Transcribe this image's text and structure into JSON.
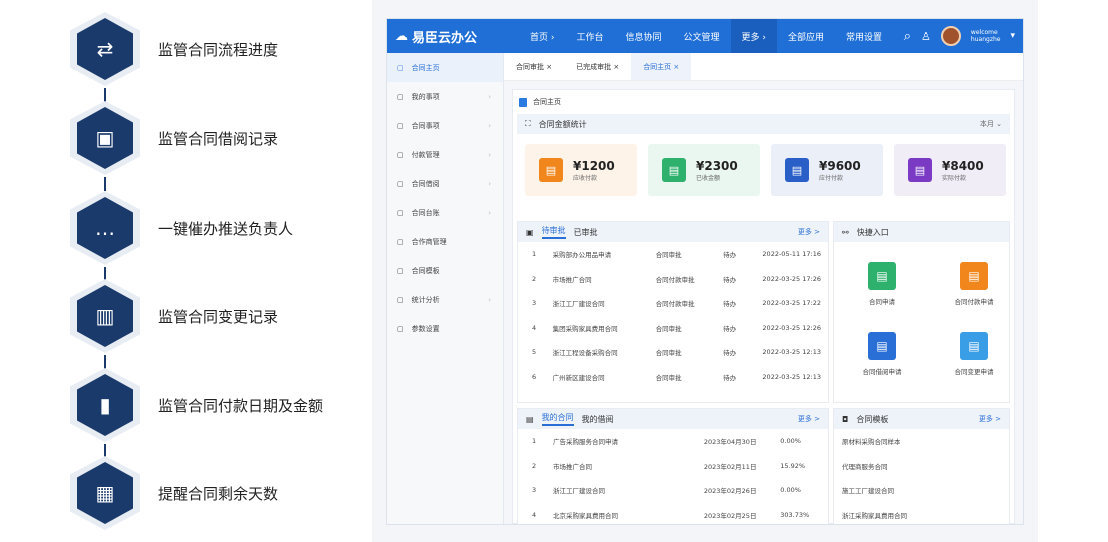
{
  "features": [
    {
      "label": "监管合同流程进度",
      "icon": "flow-icon"
    },
    {
      "label": "监管合同借阅记录",
      "icon": "tv-icon"
    },
    {
      "label": "一键催办推送负责人",
      "icon": "chat-icon"
    },
    {
      "label": "监管合同变更记录",
      "icon": "document-icon"
    },
    {
      "label": "监管合同付款日期及金额",
      "icon": "book-icon"
    },
    {
      "label": "提醒合同剩余天数",
      "icon": "calendar-icon"
    }
  ],
  "app": {
    "brand": "易臣云办公",
    "nav": [
      "首页 ›",
      "工作台",
      "信息协同",
      "公文管理",
      "更多 ›",
      "全部应用",
      "常用设置"
    ],
    "user": [
      "welcome",
      "huangzhe"
    ],
    "sidebar": [
      {
        "label": "合同主页",
        "chev": false
      },
      {
        "label": "我的事项",
        "chev": true
      },
      {
        "label": "合同事项",
        "chev": true
      },
      {
        "label": "付款管理",
        "chev": true
      },
      {
        "label": "合同借阅",
        "chev": true
      },
      {
        "label": "合同台账",
        "chev": true
      },
      {
        "label": "合作商管理",
        "chev": false
      },
      {
        "label": "合同模板",
        "chev": false
      },
      {
        "label": "统计分析",
        "chev": true
      },
      {
        "label": "参数设置",
        "chev": false
      }
    ],
    "tabs": [
      "合同审批 ×",
      "已完成审批 ×",
      "合同主页 ×"
    ],
    "page_title": "合同主页",
    "overview": {
      "title": "合同金额统计",
      "period": "本月 ⌄",
      "stats": [
        {
          "value": "¥1200",
          "label": "应收付款",
          "color": "#f0861c",
          "bg": "#fdf3e9"
        },
        {
          "value": "¥2300",
          "label": "已收金额",
          "color": "#2fb16e",
          "bg": "#eaf7f0"
        },
        {
          "value": "¥9600",
          "label": "应付付款",
          "color": "#2a5fc8",
          "bg": "#ebeff8"
        },
        {
          "value": "¥8400",
          "label": "实际付款",
          "color": "#7a3ac4",
          "bg": "#f0edf7"
        }
      ]
    },
    "todo": {
      "tabs": [
        "待审批",
        "已审批"
      ],
      "more": "更多 >",
      "rows": [
        [
          "1",
          "采购部办公用品申请",
          "合同审批",
          "待办",
          "2022-05-11 17:16"
        ],
        [
          "2",
          "市场推广合同",
          "合同付款审批",
          "待办",
          "2022-03-25 17:26"
        ],
        [
          "3",
          "浙江工厂建设合同",
          "合同付款审批",
          "待办",
          "2022-03-25 17:22"
        ],
        [
          "4",
          "集团采购家具费用合同",
          "合同审批",
          "待办",
          "2022-03-25 12:26"
        ],
        [
          "5",
          "浙江工程设备采购合同",
          "合同审批",
          "待办",
          "2022-03-25 12:13"
        ],
        [
          "6",
          "广州新区建设合同",
          "合同审批",
          "待办",
          "2022-03-25 12:13"
        ]
      ]
    },
    "quick": {
      "title": "快捷入口",
      "items": [
        {
          "label": "合同申请",
          "color": "#2fb16e"
        },
        {
          "label": "合同付款申请",
          "color": "#f0861c"
        },
        {
          "label": "合同借阅申请",
          "color": "#2a6fd6"
        },
        {
          "label": "合同变更申请",
          "color": "#3a9ee6"
        }
      ]
    },
    "pay": {
      "tabs": [
        "我的合同",
        "我的借阅"
      ],
      "more": "更多 >",
      "rows": [
        [
          "1",
          "广告采购服务合同申请",
          "2023年04月30日",
          "0.00%"
        ],
        [
          "2",
          "市场推广合同",
          "2023年02月11日",
          "15.92%"
        ],
        [
          "3",
          "浙江工厂建设合同",
          "2023年02月26日",
          "0.00%"
        ],
        [
          "4",
          "北京采购家具费用合同",
          "2023年02月25日",
          "303.73%"
        ]
      ]
    },
    "templates": {
      "title": "合同模板",
      "more": "更多 >",
      "items": [
        "原材料采购合同样本",
        "代理商服务合同",
        "施工工厂建设合同",
        "浙江采购家具费用合同"
      ]
    }
  }
}
